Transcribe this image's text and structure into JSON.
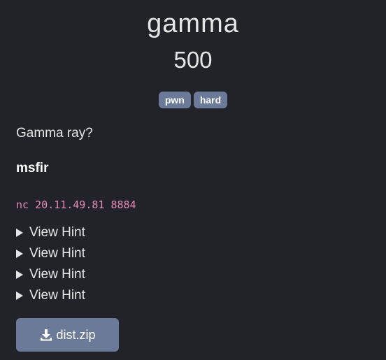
{
  "challenge": {
    "title": "gamma",
    "points": "500",
    "tags": [
      "pwn",
      "hard"
    ],
    "description": "Gamma ray?",
    "author": "msfir",
    "connection": "nc 20.11.49.81 8884",
    "hints": [
      "View Hint",
      "View Hint",
      "View Hint",
      "View Hint"
    ],
    "file_label": "dist.zip"
  },
  "icons": {
    "hint_toggle": "triangle-right-icon",
    "download": "download-icon"
  },
  "colors": {
    "background": "#212329",
    "tag_badge": "#6c7a99",
    "button": "#6c7a99",
    "connection_text": "#e58bb4"
  }
}
